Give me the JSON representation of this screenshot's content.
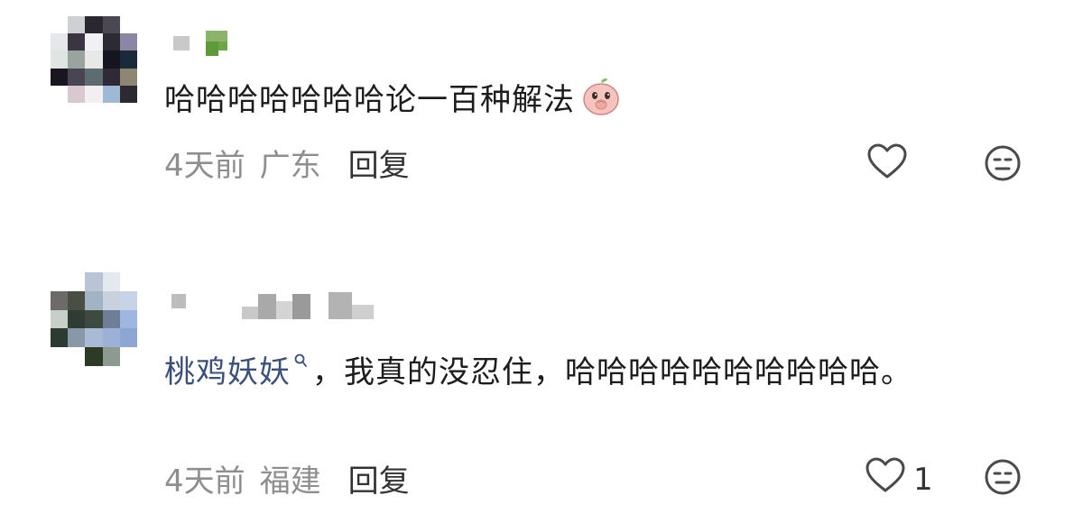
{
  "comments": [
    {
      "username": "",
      "text": "哈哈哈哈哈哈哈论一百种解法",
      "emoji": "peach-face-emoji",
      "time": "4天前",
      "location": "广东",
      "reply_label": "回复",
      "like_count": "",
      "like_icon": "heart-outline-icon",
      "dislike_icon": "neutral-face-icon"
    },
    {
      "username": "",
      "mention": "桃鸡妖妖",
      "text_after_mention": "，我真的没忍住，哈哈哈哈哈哈哈哈哈哈。",
      "time": "4天前",
      "location": "福建",
      "reply_label": "回复",
      "like_count": "1",
      "like_icon": "heart-outline-icon",
      "dislike_icon": "neutral-face-icon"
    }
  ],
  "colors": {
    "mention": "#3a4f7a",
    "meta_text": "#8e8e8e",
    "reply_text": "#333333",
    "body_text": "#1c1c1c"
  }
}
